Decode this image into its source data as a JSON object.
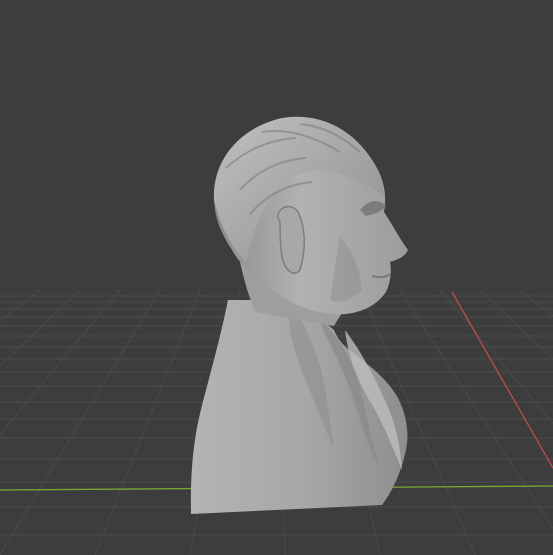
{
  "viewport": {
    "view": "3d-viewport",
    "background_color": "#3d3d3d",
    "grid_color": "#4a4a4a",
    "x_axis_color": "#c24a4a",
    "y_axis_color": "#7aa832",
    "object": {
      "type": "sculpted-bust",
      "color": "#a3a3a3"
    }
  }
}
